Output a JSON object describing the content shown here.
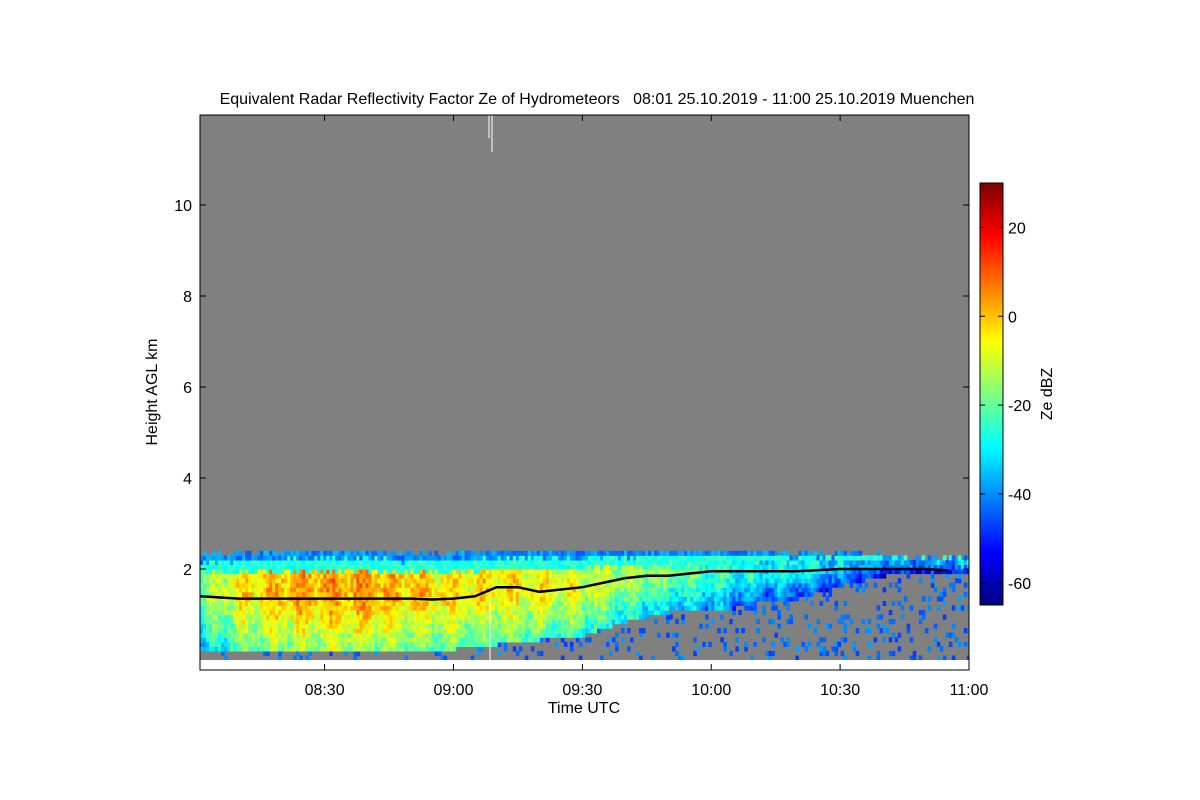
{
  "chart_data": {
    "type": "heatmap",
    "title": "Equivalent Radar Reflectivity Factor Ze of Hydrometeors   08:01 25.10.2019 - 11:00 25.10.2019 Muenchen",
    "xlabel": "Time UTC",
    "ylabel": "Height AGL km",
    "colorbar_label": "Ze dBZ",
    "x_range_minutes": [
      481,
      660
    ],
    "x_ticks": [
      {
        "label": "08:30",
        "minutes": 510
      },
      {
        "label": "09:00",
        "minutes": 540
      },
      {
        "label": "09:30",
        "minutes": 570
      },
      {
        "label": "10:00",
        "minutes": 600
      },
      {
        "label": "10:30",
        "minutes": 630
      },
      {
        "label": "11:00",
        "minutes": 660
      }
    ],
    "ylim": [
      0,
      12
    ],
    "y_ticks": [
      {
        "label": "2",
        "value": 2
      },
      {
        "label": "4",
        "value": 4
      },
      {
        "label": "6",
        "value": 6
      },
      {
        "label": "8",
        "value": 8
      },
      {
        "label": "10",
        "value": 10
      }
    ],
    "color_range_dbz": [
      -65,
      30
    ],
    "colorbar_ticks": [
      {
        "label": "20",
        "value": 20
      },
      {
        "label": "0",
        "value": 0
      },
      {
        "label": "-20",
        "value": -20
      },
      {
        "label": "-40",
        "value": -40
      },
      {
        "label": "-60",
        "value": -60
      }
    ],
    "no_signal_color": "#808080",
    "colormap": [
      "#00007f",
      "#0000ff",
      "#007fff",
      "#00ffff",
      "#7fff7f",
      "#ffff00",
      "#ff7f00",
      "#ff0000",
      "#7f0000"
    ],
    "cloud_layer": {
      "description_points": [
        {
          "minutes": 481,
          "top_km": 2.3,
          "base_km": 0.2,
          "dbz_max": -10
        },
        {
          "minutes": 490,
          "top_km": 2.3,
          "base_km": 0.2,
          "dbz_max": 5
        },
        {
          "minutes": 500,
          "top_km": 2.35,
          "base_km": 0.2,
          "dbz_max": 10
        },
        {
          "minutes": 510,
          "top_km": 2.35,
          "base_km": 0.2,
          "dbz_max": 12
        },
        {
          "minutes": 520,
          "top_km": 2.35,
          "base_km": 0.2,
          "dbz_max": 12
        },
        {
          "minutes": 530,
          "top_km": 2.3,
          "base_km": 0.2,
          "dbz_max": 8
        },
        {
          "minutes": 540,
          "top_km": 2.3,
          "base_km": 0.2,
          "dbz_max": 5
        },
        {
          "minutes": 550,
          "top_km": 2.35,
          "base_km": 0.3,
          "dbz_max": 5
        },
        {
          "minutes": 560,
          "top_km": 2.35,
          "base_km": 0.4,
          "dbz_max": 3
        },
        {
          "minutes": 570,
          "top_km": 2.35,
          "base_km": 0.5,
          "dbz_max": 0
        },
        {
          "minutes": 580,
          "top_km": 2.35,
          "base_km": 0.8,
          "dbz_max": -5
        },
        {
          "minutes": 590,
          "top_km": 2.35,
          "base_km": 1.0,
          "dbz_max": -10
        },
        {
          "minutes": 600,
          "top_km": 2.35,
          "base_km": 1.0,
          "dbz_max": -15
        },
        {
          "minutes": 610,
          "top_km": 2.35,
          "base_km": 1.2,
          "dbz_max": -20
        },
        {
          "minutes": 620,
          "top_km": 2.3,
          "base_km": 1.3,
          "dbz_max": -20
        },
        {
          "minutes": 630,
          "top_km": 2.3,
          "base_km": 1.6,
          "dbz_max": -25
        },
        {
          "minutes": 640,
          "top_km": 2.25,
          "base_km": 1.8,
          "dbz_max": -30
        },
        {
          "minutes": 650,
          "top_km": 2.2,
          "base_km": 1.85,
          "dbz_max": -30
        },
        {
          "minutes": 660,
          "top_km": 2.2,
          "base_km": 1.85,
          "dbz_max": -30
        }
      ]
    },
    "cloud_base_line": {
      "color": "#000000",
      "points": [
        {
          "minutes": 481,
          "km": 1.4
        },
        {
          "minutes": 490,
          "km": 1.35
        },
        {
          "minutes": 500,
          "km": 1.35
        },
        {
          "minutes": 510,
          "km": 1.35
        },
        {
          "minutes": 520,
          "km": 1.35
        },
        {
          "minutes": 530,
          "km": 1.35
        },
        {
          "minutes": 535,
          "km": 1.33
        },
        {
          "minutes": 540,
          "km": 1.35
        },
        {
          "minutes": 545,
          "km": 1.4
        },
        {
          "minutes": 550,
          "km": 1.6
        },
        {
          "minutes": 555,
          "km": 1.6
        },
        {
          "minutes": 560,
          "km": 1.5
        },
        {
          "minutes": 565,
          "km": 1.55
        },
        {
          "minutes": 570,
          "km": 1.6
        },
        {
          "minutes": 575,
          "km": 1.7
        },
        {
          "minutes": 580,
          "km": 1.8
        },
        {
          "minutes": 585,
          "km": 1.85
        },
        {
          "minutes": 590,
          "km": 1.85
        },
        {
          "minutes": 595,
          "km": 1.9
        },
        {
          "minutes": 600,
          "km": 1.95
        },
        {
          "minutes": 605,
          "km": 1.95
        },
        {
          "minutes": 610,
          "km": 1.95
        },
        {
          "minutes": 620,
          "km": 1.95
        },
        {
          "minutes": 630,
          "km": 2.0
        },
        {
          "minutes": 640,
          "km": 2.0
        },
        {
          "minutes": 650,
          "km": 2.0
        },
        {
          "minutes": 655,
          "km": 1.97
        }
      ]
    },
    "grid": false,
    "legend": "colorbar-right"
  }
}
